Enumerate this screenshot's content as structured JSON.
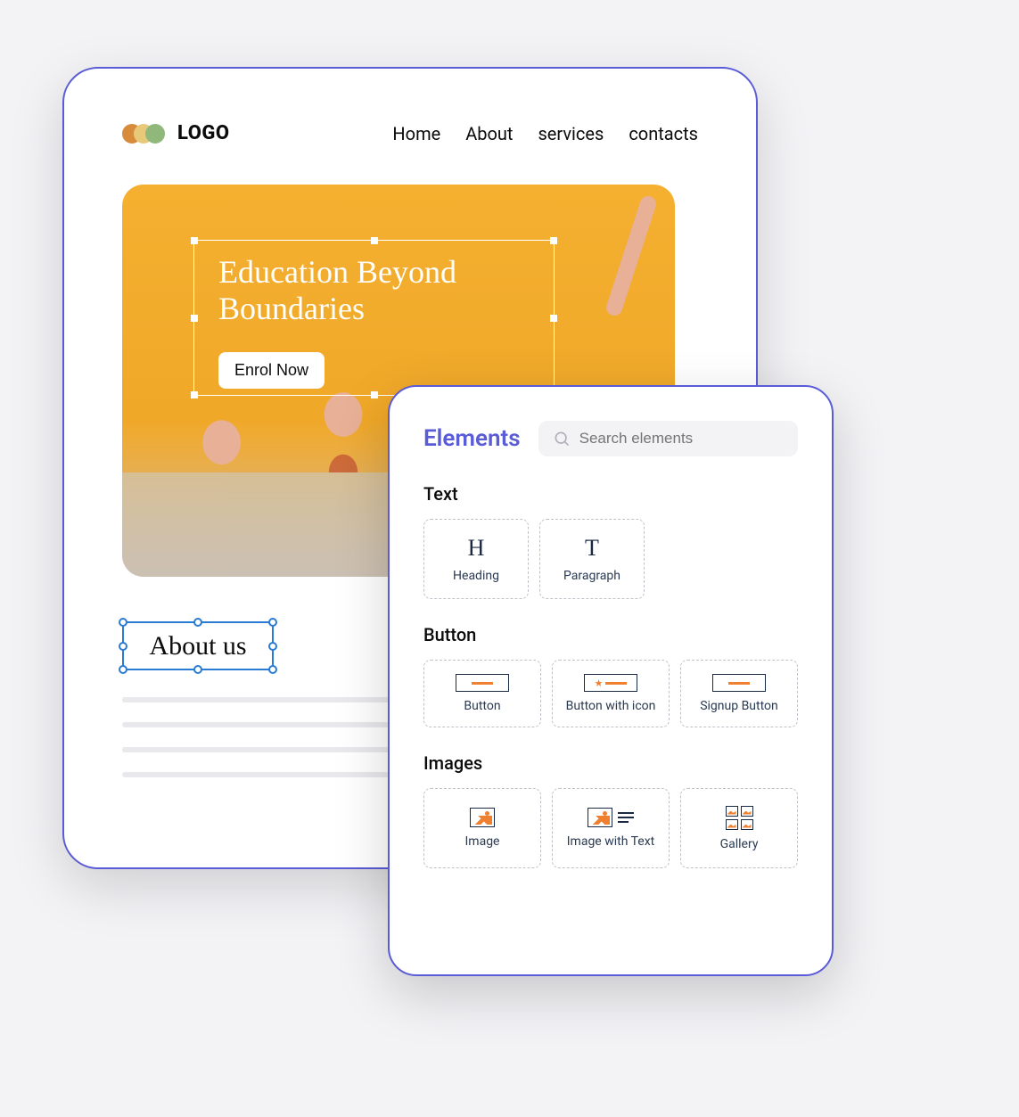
{
  "editor": {
    "logo_text": "LOGO",
    "nav": [
      "Home",
      "About",
      "services",
      "contacts"
    ],
    "hero": {
      "title": "Education Beyond Boundaries",
      "cta": "Enrol Now"
    },
    "about_heading": "About us"
  },
  "elements_panel": {
    "title": "Elements",
    "search_placeholder": "Search elements",
    "sections": {
      "text": {
        "label": "Text",
        "items": [
          {
            "glyph": "H",
            "label": "Heading"
          },
          {
            "glyph": "T",
            "label": "Paragraph"
          }
        ]
      },
      "button": {
        "label": "Button",
        "items": [
          {
            "label": "Button"
          },
          {
            "label": "Button with icon"
          },
          {
            "label": "Signup Button"
          }
        ]
      },
      "images": {
        "label": "Images",
        "items": [
          {
            "label": "Image"
          },
          {
            "label": "Image with Text"
          },
          {
            "label": "Gallery"
          }
        ]
      }
    }
  },
  "colors": {
    "accent": "#5a5bd6",
    "icon_orange": "#f08030",
    "selection_blue": "#2a7bd4"
  }
}
